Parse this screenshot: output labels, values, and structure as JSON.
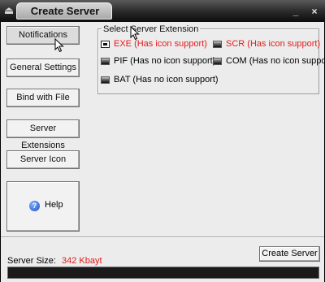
{
  "window": {
    "title": "Create Server",
    "app_icon": "eject-icon",
    "controls": [
      "minimize-icon",
      "close-icon"
    ]
  },
  "sidebar": {
    "buttons": [
      {
        "label": "Notifications"
      },
      {
        "label": "General Settings"
      },
      {
        "label": "Bind with File"
      },
      {
        "label": "Server Extensions"
      },
      {
        "label": "Server Icon"
      }
    ],
    "help": {
      "label": "Help",
      "icon": "help-icon"
    }
  },
  "extension_group": {
    "title": "Select Server Extension",
    "options": [
      {
        "label": "EXE (Has icon support)",
        "selected": true,
        "color": "#e41b1b"
      },
      {
        "label": "SCR (Has icon support)",
        "selected": false,
        "color": "#e41b1b"
      },
      {
        "label": "PIF (Has no icon support)",
        "selected": false,
        "color": "#000000"
      },
      {
        "label": "COM (Has no icon support)",
        "selected": false,
        "color": "#000000"
      },
      {
        "label": "BAT (Has no icon support)",
        "selected": false,
        "color": "#000000"
      }
    ]
  },
  "footer": {
    "size_label": "Server Size:",
    "size_value": "342 Kbayt",
    "size_value_color": "#e41b1b",
    "create_button": "Create Server",
    "progress_fraction": 1.0
  }
}
